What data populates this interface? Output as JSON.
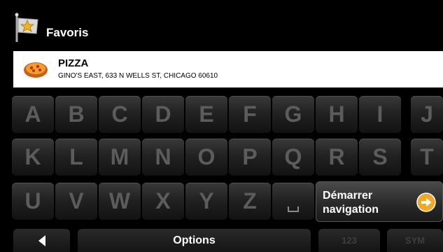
{
  "header": {
    "title": "Favoris",
    "icon": "favorite-flag-icon"
  },
  "favorite": {
    "name": "PIZZA",
    "address": "GINO'S EAST, 633 N WELLS ST, CHICAGO 60610",
    "icon": "pizza-icon"
  },
  "keyboard": {
    "rows": [
      [
        "A",
        "B",
        "C",
        "D",
        "E",
        "F",
        "G",
        "H",
        "I",
        "J"
      ],
      [
        "K",
        "L",
        "M",
        "N",
        "O",
        "P",
        "Q",
        "R",
        "S",
        "T"
      ],
      [
        "U",
        "V",
        "W",
        "X",
        "Y",
        "Z"
      ]
    ],
    "space_key_icon": "space-bar-icon"
  },
  "start_navigation": {
    "line1": "Démarrer",
    "line2": "navigation",
    "icon": "arrow-right-circle-icon",
    "icon_color": "#f5a623"
  },
  "bottom_bar": {
    "back_icon": "back-arrow-icon",
    "options_label": "Options",
    "num_label": "123",
    "sym_label": "SYM"
  }
}
